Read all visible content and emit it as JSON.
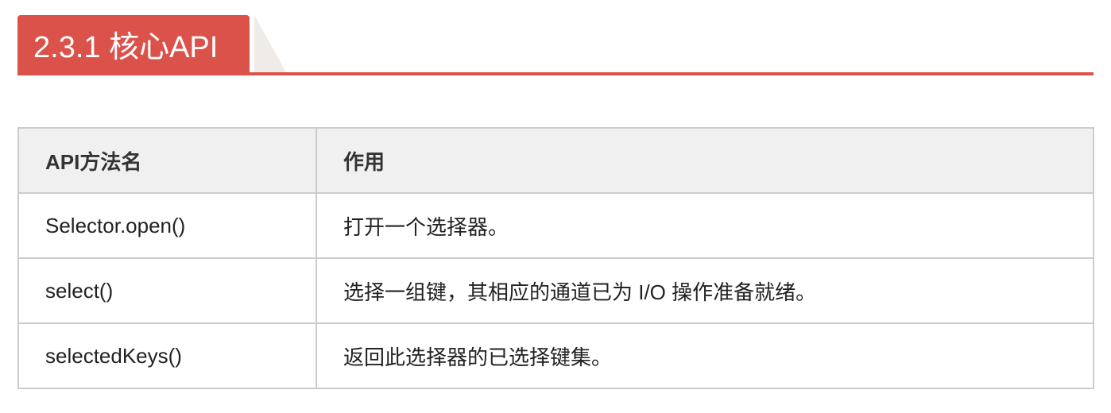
{
  "heading": {
    "title": "2.3.1 核心API",
    "accent_color": "#db524b"
  },
  "table": {
    "headers": [
      "API方法名",
      "作用"
    ],
    "rows": [
      [
        "Selector.open()",
        "打开一个选择器。"
      ],
      [
        "select()",
        "选择一组键，其相应的通道已为 I/O 操作准备就绪。"
      ],
      [
        "selectedKeys()",
        "返回此选择器的已选择键集。"
      ]
    ]
  }
}
